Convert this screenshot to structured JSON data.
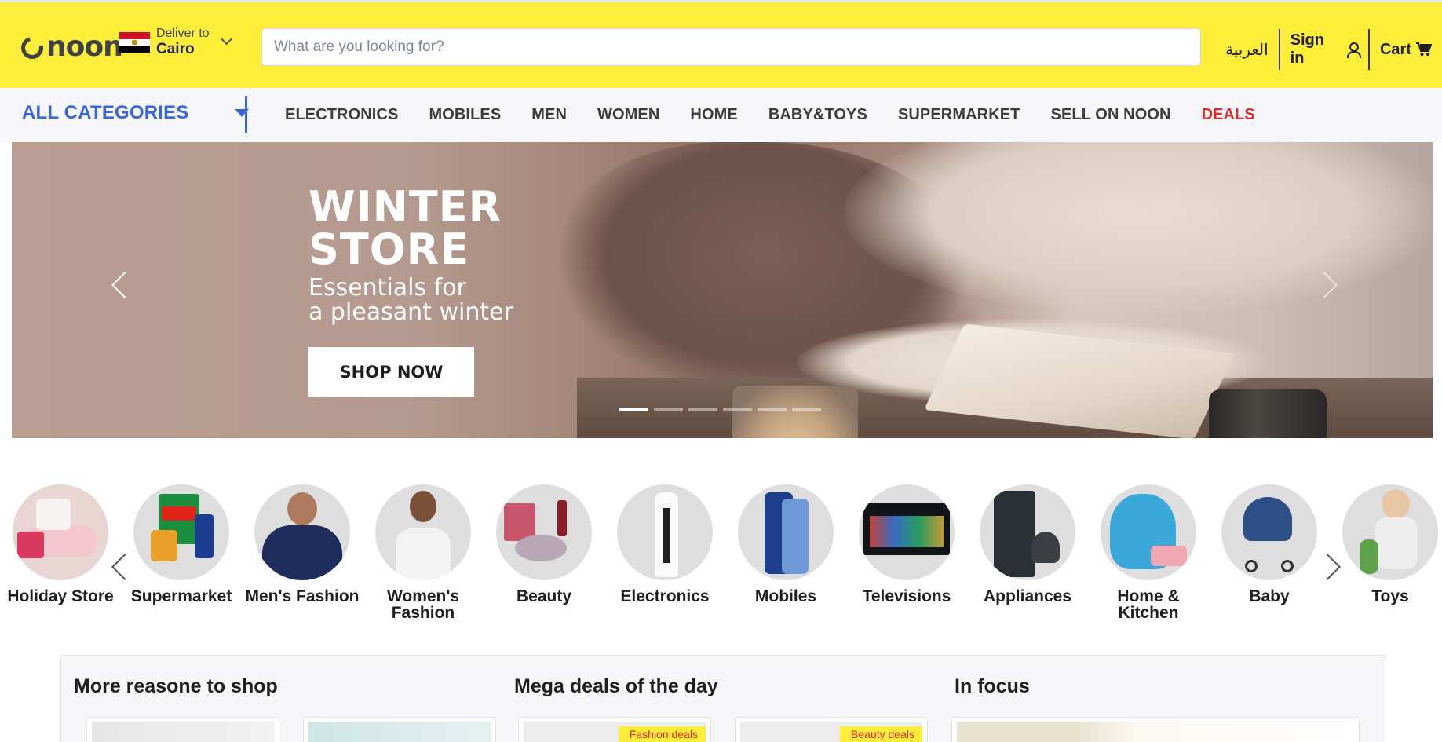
{
  "header": {
    "logo_text": "noon",
    "deliver_label": "Deliver to",
    "deliver_city": "Cairo",
    "search_placeholder": "What are you looking for?",
    "language_link": "العربية",
    "signin_label": "Sign in",
    "cart_label": "Cart",
    "bg_color": "#feee3a"
  },
  "nav": {
    "all_categories": "ALL CATEGORIES",
    "items": [
      "ELECTRONICS",
      "MOBILES",
      "MEN",
      "WOMEN",
      "HOME",
      "BABY&TOYS",
      "SUPERMARKET",
      "SELL ON NOON",
      "DEALS"
    ],
    "accent_color": "#3866df",
    "deals_color": "#e02b2b"
  },
  "banner": {
    "title_line1": "WINTER",
    "title_line2": "STORE",
    "subtitle_line1": "Essentials for",
    "subtitle_line2": "a pleasant winter",
    "button": "SHOP NOW",
    "slide_count": 6,
    "active_slide": 1
  },
  "categories": [
    {
      "label": "Holiday Store",
      "icon": "holiday-gifts"
    },
    {
      "label": "Supermarket",
      "icon": "groceries"
    },
    {
      "label": "Men's Fashion",
      "icon": "mens-tshirt"
    },
    {
      "label": "Women's Fashion",
      "icon": "womens-top"
    },
    {
      "label": "Beauty",
      "icon": "makeup-perfume"
    },
    {
      "label": "Electronics",
      "icon": "game-console"
    },
    {
      "label": "Mobiles",
      "icon": "smartphone"
    },
    {
      "label": "Televisions",
      "icon": "tv-screen"
    },
    {
      "label": "Appliances",
      "icon": "fridge-vacuum"
    },
    {
      "label": "Home & Kitchen",
      "icon": "bean-bag"
    },
    {
      "label": "Baby",
      "icon": "stroller"
    },
    {
      "label": "Toys",
      "icon": "toy-figure"
    }
  ],
  "sections": {
    "more_reasons": "More reasone to shop",
    "mega_deals": "Mega deals of the day",
    "in_focus": "In focus",
    "fashion_tag": "Fashion deals",
    "beauty_tag": "Beauty deals"
  }
}
